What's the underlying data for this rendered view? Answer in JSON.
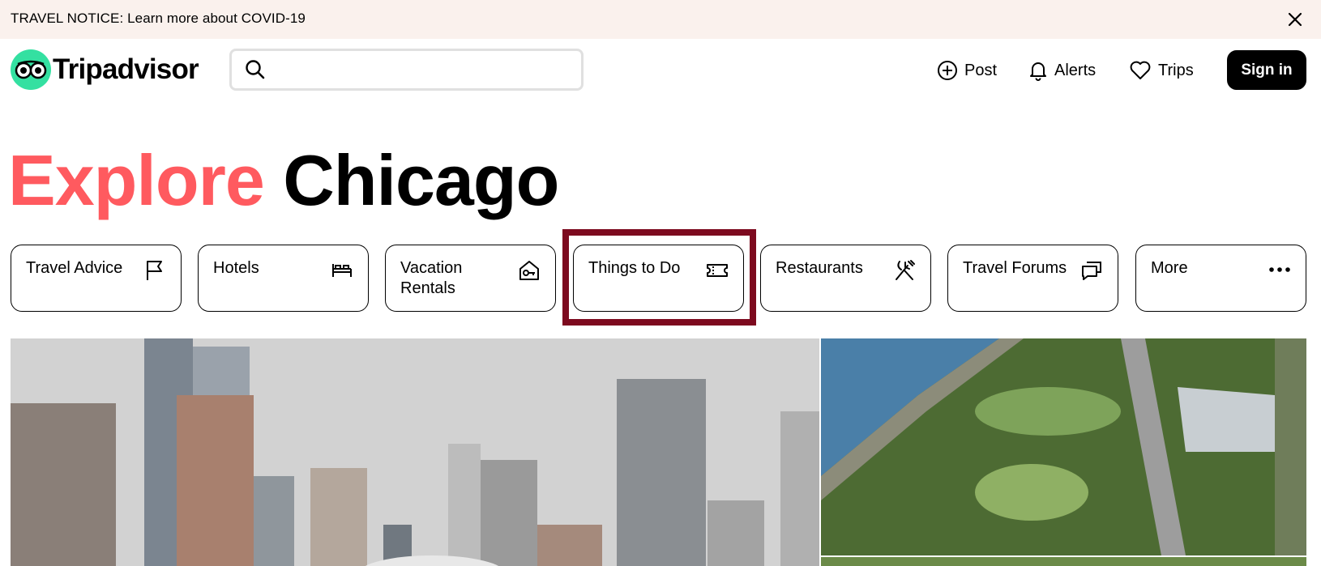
{
  "notice": {
    "text": "TRAVEL NOTICE: Learn more about COVID-19",
    "close_icon": "close-icon"
  },
  "header": {
    "logo_text": "Tripadvisor",
    "search": {
      "placeholder": "",
      "value": ""
    },
    "nav": {
      "post": "Post",
      "alerts": "Alerts",
      "trips": "Trips"
    },
    "sign_in": "Sign in"
  },
  "headline": {
    "explore": "Explore",
    "city": "Chicago"
  },
  "categories": [
    {
      "label": "Travel Advice",
      "icon": "flag-icon"
    },
    {
      "label": "Hotels",
      "icon": "bed-icon"
    },
    {
      "label": "Vacation Rentals",
      "icon": "house-key-icon"
    },
    {
      "label": "Things to Do",
      "icon": "ticket-icon"
    },
    {
      "label": "Restaurants",
      "icon": "fork-knife-icon"
    },
    {
      "label": "Travel Forums",
      "icon": "chat-icon"
    },
    {
      "label": "More",
      "icon": "more-dots-icon"
    }
  ],
  "colors": {
    "brand_green": "#34e0a1",
    "explore_red": "#ff5a5f",
    "notice_bg": "#faf1ed",
    "highlight": "#7d0a1f"
  }
}
